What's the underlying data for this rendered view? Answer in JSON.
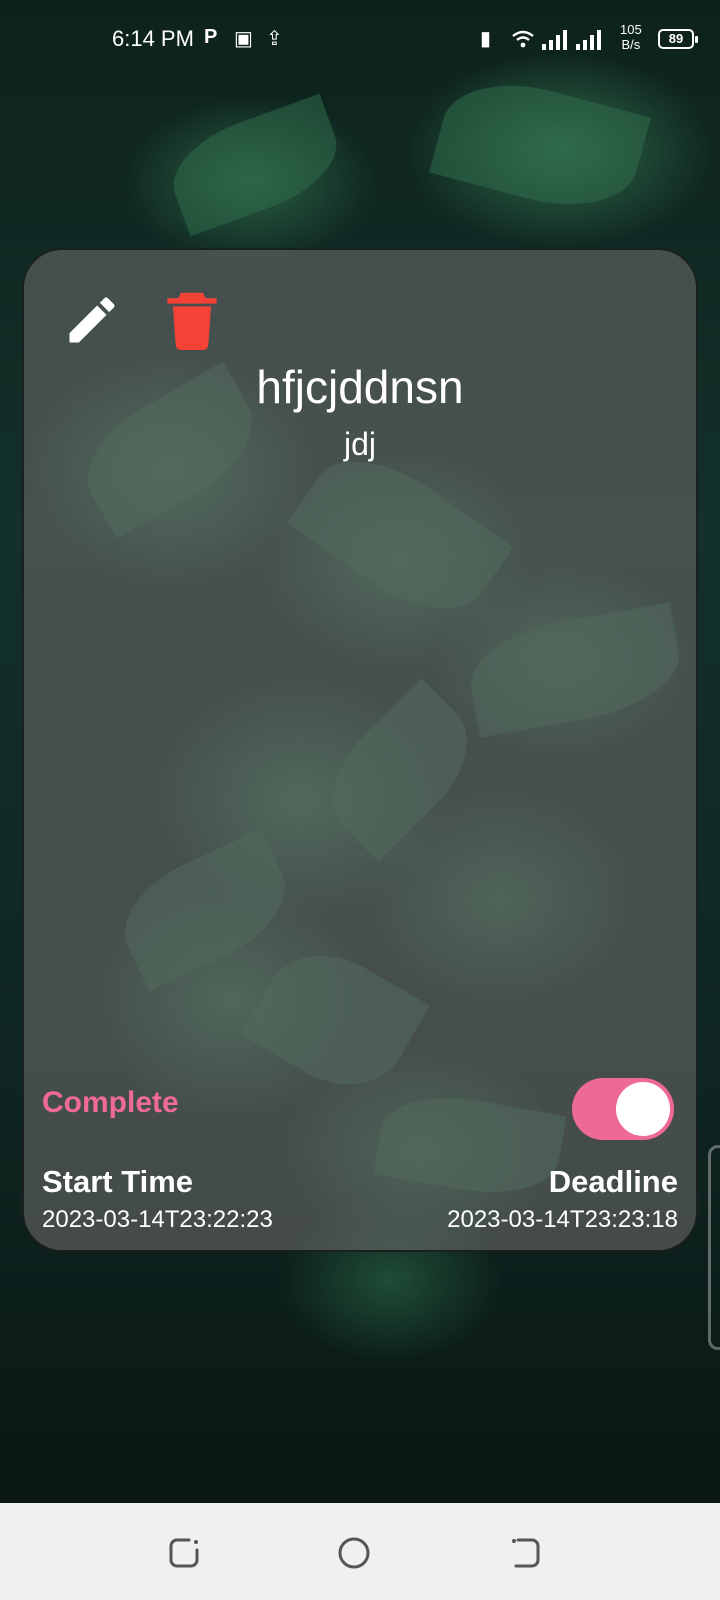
{
  "status_bar": {
    "time": "6:14 PM",
    "net_speed_value": "105",
    "net_speed_unit": "B/s",
    "battery": "89"
  },
  "task": {
    "title": "hfjcjddnsn",
    "description": "jdj",
    "complete_label": "Complete",
    "complete": true,
    "start_label": "Start Time",
    "start_value": "2023-03-14T23:22:23",
    "deadline_label": "Deadline",
    "deadline_value": "2023-03-14T23:23:18"
  },
  "icons": {
    "edit": "pencil-icon",
    "delete": "trash-icon",
    "nav_recents": "recents-icon",
    "nav_home": "home-icon",
    "nav_back": "back-icon"
  },
  "colors": {
    "accent": "#ee6a95",
    "delete": "#f44336",
    "card": "rgba(105,105,105,0.60)",
    "navbar": "#f0f0f0"
  }
}
